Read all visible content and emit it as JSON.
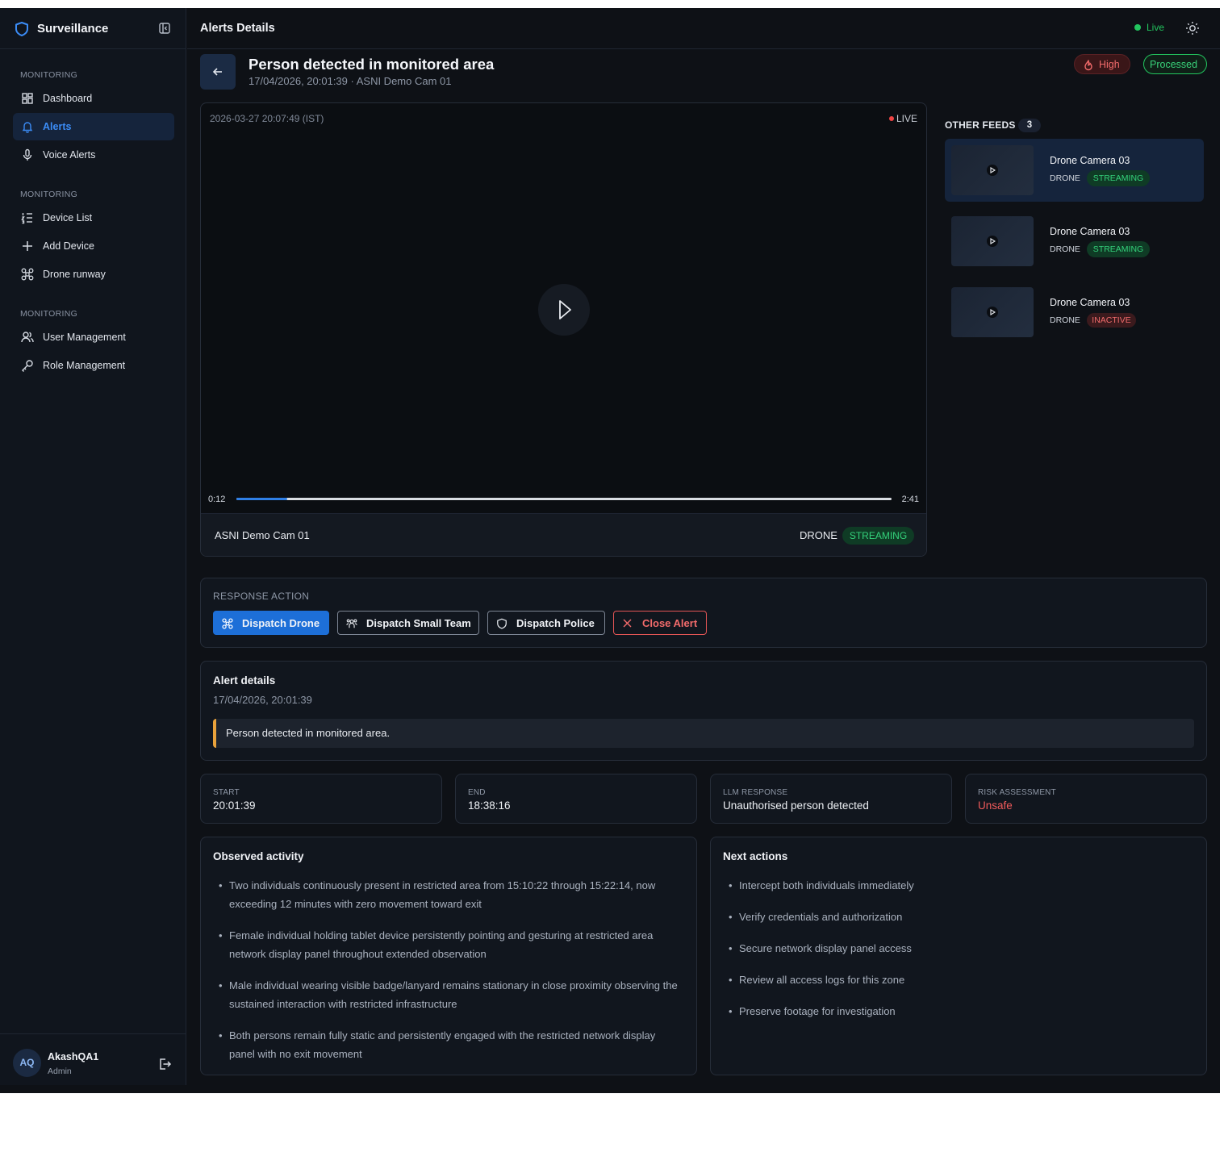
{
  "app": {
    "brand": "Surveillance",
    "header_title": "Alerts Details",
    "live_label": "Live"
  },
  "sidebar": {
    "sections": [
      {
        "title": "MONITORING",
        "items": [
          {
            "label": "Dashboard",
            "icon": "dashboard-icon",
            "active": false
          },
          {
            "label": "Alerts",
            "icon": "bell-icon",
            "active": true
          },
          {
            "label": "Voice Alerts",
            "icon": "microphone-icon",
            "active": false
          }
        ]
      },
      {
        "title": "MONITORING",
        "items": [
          {
            "label": "Device List",
            "icon": "list-icon",
            "active": false
          },
          {
            "label": "Add Device",
            "icon": "plus-icon",
            "active": false
          },
          {
            "label": "Drone runway",
            "icon": "drone-icon",
            "active": false
          }
        ]
      },
      {
        "title": "MONITORING",
        "items": [
          {
            "label": "User Management",
            "icon": "users-icon",
            "active": false
          },
          {
            "label": "Role Management",
            "icon": "key-icon",
            "active": false
          }
        ]
      }
    ],
    "user": {
      "initials": "AQ",
      "name": "AkashQA1",
      "role": "Admin"
    }
  },
  "alert": {
    "title": "Person detected in monitored area",
    "subtitle": "17/04/2026, 20:01:39 · ASNI Demo Cam 01",
    "severity": "High",
    "status": "Processed"
  },
  "video": {
    "timestamp": "2026-03-27 20:07:49 (IST)",
    "live_label": "LIVE",
    "current_time": "0:12",
    "duration": "2:41",
    "progress_fraction": 0.078,
    "camera_name": "ASNI Demo Cam 01",
    "device_type": "DRONE",
    "stream_status": "STREAMING"
  },
  "feeds": {
    "label": "OTHER FEEDS",
    "count": "3",
    "items": [
      {
        "name": "Drone Camera 03",
        "type": "DRONE",
        "status": "STREAMING",
        "active": true
      },
      {
        "name": "Drone Camera 03",
        "type": "DRONE",
        "status": "STREAMING",
        "active": false
      },
      {
        "name": "Drone Camera 03",
        "type": "DRONE",
        "status": "INACTIVE",
        "active": false
      }
    ]
  },
  "response": {
    "label": "RESPONSE ACTION",
    "dispatch_drone": "Dispatch Drone",
    "dispatch_team": "Dispatch Small Team",
    "dispatch_police": "Dispatch Police",
    "close_alert": "Close Alert"
  },
  "details": {
    "title": "Alert details",
    "date": "17/04/2026, 20:01:39",
    "message": "Person detected in monitored area."
  },
  "stats": {
    "start_label": "START",
    "start_value": "20:01:39",
    "end_label": "END",
    "end_value": "18:38:16",
    "llm_label": "LLM RESPONSE",
    "llm_value": "Unauthorised person detected",
    "risk_label": "RISK ASSESSMENT",
    "risk_value": "Unsafe"
  },
  "observed": {
    "title": "Observed activity",
    "items": [
      "Two individuals continuously present in restricted area from 15:10:22 through 15:22:14, now exceeding 12 minutes with zero movement toward exit",
      "Female individual holding tablet device persistently pointing and gesturing at restricted area network display panel throughout extended observation",
      "Male individual wearing visible badge/lanyard remains stationary in close proximity observing the sustained interaction with restricted infrastructure",
      "Both persons remain fully static and persistently engaged with the restricted network display panel with no exit movement"
    ]
  },
  "next_actions": {
    "title": "Next actions",
    "items": [
      "Intercept both individuals immediately",
      "Verify credentials and authorization",
      "Secure network display panel access",
      "Review all access logs for this zone",
      "Preserve footage for investigation"
    ]
  },
  "colors": {
    "accent": "#1d6fd8",
    "live_green": "#22c55e",
    "danger_red": "#f15b5b",
    "warning_amber": "#e9a23b",
    "background": "#0e1116"
  }
}
